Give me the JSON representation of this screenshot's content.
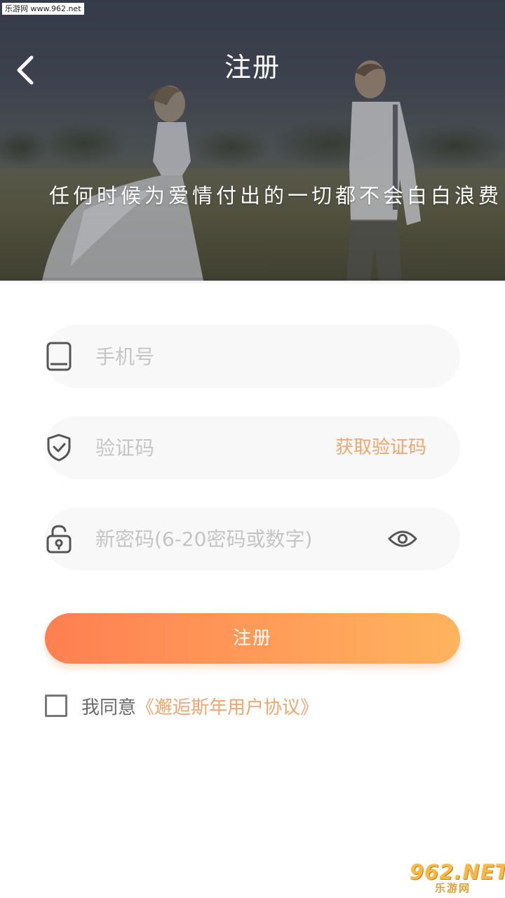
{
  "watermark": {
    "top": "乐游网 www.962.net",
    "bottom_logo": "962.NET",
    "bottom_sub": "乐游网"
  },
  "header": {
    "title": "注册",
    "back_icon": "chevron-left-icon",
    "slogan": "任何时候为爱情付出的一切都不会白白浪费"
  },
  "form": {
    "phone": {
      "placeholder": "手机号",
      "value": "",
      "icon": "phone-icon"
    },
    "code": {
      "placeholder": "验证码",
      "value": "",
      "icon": "shield-check-icon",
      "get_code_label": "获取验证码"
    },
    "password": {
      "placeholder": "新密码(6-20密码或数字)",
      "value": "",
      "icon": "lock-icon",
      "toggle_icon": "eye-icon"
    },
    "submit_label": "注册"
  },
  "agreement": {
    "checked": false,
    "prefix": "我同意",
    "link": "《邂逅斯年用户协议》"
  },
  "colors": {
    "accent": "#f2a56e",
    "button_gradient_start": "#ff7f52",
    "button_gradient_end": "#ffb45e",
    "field_background": "#f8f8f8",
    "placeholder": "#c5c5c5"
  }
}
